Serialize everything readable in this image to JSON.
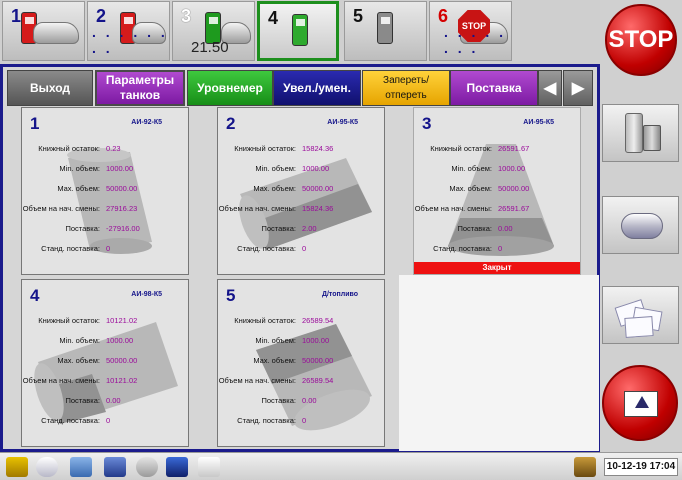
{
  "pumps": [
    {
      "number": "1",
      "value": "",
      "dots": "",
      "state": "car-red"
    },
    {
      "number": "2",
      "value": "",
      "dots": ". . . . . . . .",
      "state": "car-red"
    },
    {
      "number": "3",
      "value": "21.50",
      "dots": "",
      "state": "car-green"
    },
    {
      "number": "4",
      "value": "",
      "dots": "",
      "state": "green-selected"
    },
    {
      "number": "5",
      "value": "",
      "dots": "",
      "state": "gray"
    },
    {
      "number": "6",
      "value": "",
      "dots": ". . . . . . . .",
      "state": "stop"
    }
  ],
  "right_panel": {
    "stop_label": "STOP",
    "buttons": [
      "dispenser-icon",
      "tank-icon",
      "documents-icon"
    ]
  },
  "tabs": {
    "exit": "Выход",
    "tank_params_line1": "Параметры",
    "tank_params_line2": "танков",
    "level_gauge": "Уровнемер",
    "inc_dec": "Увел./умен.",
    "lock_unlock": "Запереть/отпереть",
    "supply": "Поставка"
  },
  "labels": {
    "book_balance": "Книжный остаток:",
    "min_volume": "Min. объем:",
    "max_volume": "Max. объем:",
    "shift_start_volume": "Объем на нач. смены:",
    "supply": "Поставка:",
    "std_supply": "Станд. поставка:",
    "closed": "Закрыт"
  },
  "tanks": [
    {
      "number": "1",
      "fuel": "АИ-92-К5",
      "book": "0.23",
      "min": "1000.00",
      "max": "50000.00",
      "shift_start": "27916.23",
      "supply": "-27916.00",
      "std_supply": "0",
      "closed": false
    },
    {
      "number": "2",
      "fuel": "АИ-95-К5",
      "book": "15824.36",
      "min": "1000.00",
      "max": "50000.00",
      "shift_start": "15824.36",
      "supply": "2.00",
      "std_supply": "0",
      "closed": false
    },
    {
      "number": "3",
      "fuel": "АИ-95-К5",
      "book": "26591.67",
      "min": "1000.00",
      "max": "50000.00",
      "shift_start": "26591.67",
      "supply": "0.00",
      "std_supply": "0",
      "closed": true
    },
    {
      "number": "4",
      "fuel": "АИ-98-К5",
      "book": "10121.02",
      "min": "1000.00",
      "max": "50000.00",
      "shift_start": "10121.02",
      "supply": "0.00",
      "std_supply": "0",
      "closed": false
    },
    {
      "number": "5",
      "fuel": "Д/топливо",
      "book": "26589.54",
      "min": "1000.00",
      "max": "50000.00",
      "shift_start": "26589.54",
      "supply": "0.00",
      "std_supply": "0",
      "closed": false
    }
  ],
  "taskbar": {
    "icons": [
      "fuel-icon",
      "tank-icon",
      "card-icon",
      "card-reader-icon",
      "scanner-icon",
      "terminal-icon",
      "printer-icon",
      "speaker-icon"
    ],
    "clock": "10-12-19 17:04"
  },
  "colors": {
    "accent_blue": "#1b1b8c",
    "purple": "#9a0b9a",
    "selected_green": "#1d8f1d",
    "closed_red": "#ee1111"
  }
}
